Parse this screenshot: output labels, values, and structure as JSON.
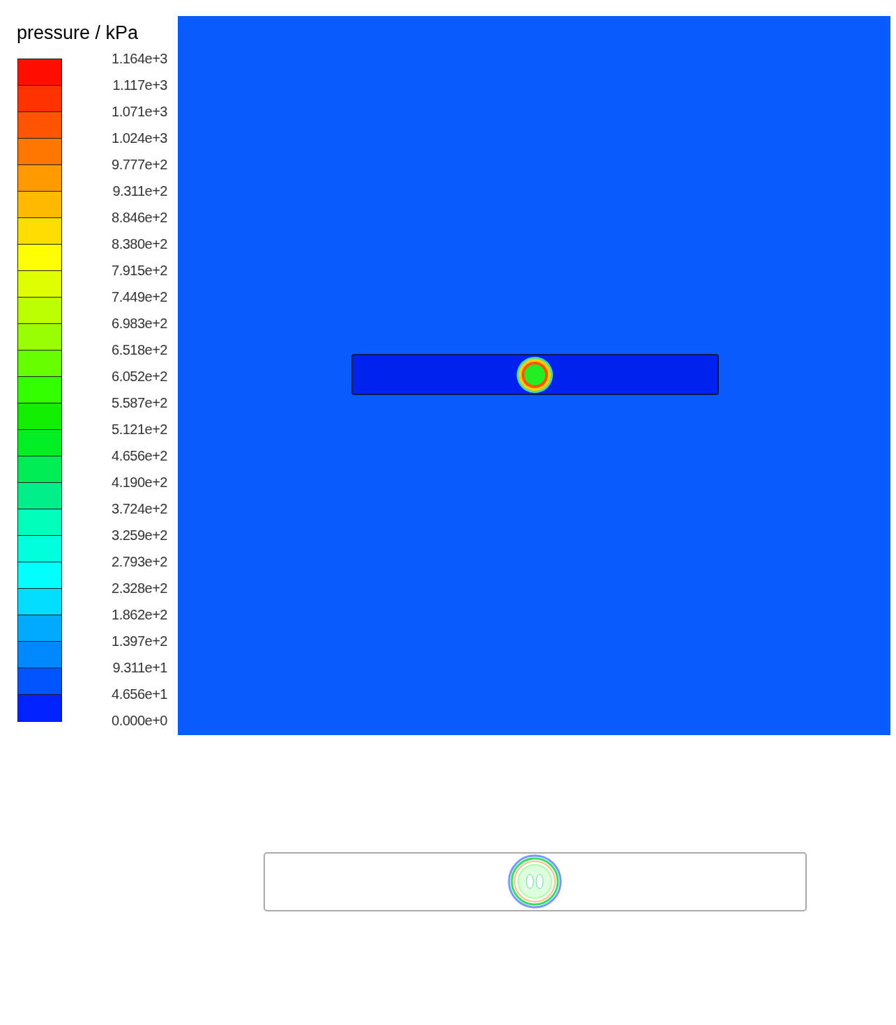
{
  "legend": {
    "title": "pressure / kPa",
    "labels": [
      "1.164e+3",
      "1.117e+3",
      "1.071e+3",
      "1.024e+3",
      "9.777e+2",
      "9.311e+2",
      "8.846e+2",
      "8.380e+2",
      "7.915e+2",
      "7.449e+2",
      "6.983e+2",
      "6.518e+2",
      "6.052e+2",
      "5.587e+2",
      "5.121e+2",
      "4.656e+2",
      "4.190e+2",
      "3.724e+2",
      "3.259e+2",
      "2.793e+2",
      "2.328e+2",
      "1.862e+2",
      "1.397e+2",
      "9.311e+1",
      "4.656e+1",
      "0.000e+0"
    ],
    "bands": [
      {
        "color": "#ff1000"
      },
      {
        "color": "#ff3300"
      },
      {
        "color": "#ff5500"
      },
      {
        "color": "#ff7700"
      },
      {
        "color": "#ff9900"
      },
      {
        "color": "#ffbb00"
      },
      {
        "color": "#ffdd00"
      },
      {
        "color": "#ffff00"
      },
      {
        "color": "#ddff00"
      },
      {
        "color": "#bbff00"
      },
      {
        "color": "#99ff00"
      },
      {
        "color": "#66ff00"
      },
      {
        "color": "#33ff00"
      },
      {
        "color": "#11ee00"
      },
      {
        "color": "#00ee22"
      },
      {
        "color": "#00ee55"
      },
      {
        "color": "#00ee88"
      },
      {
        "color": "#00ffbb"
      },
      {
        "color": "#00ffdd"
      },
      {
        "color": "#00ffff"
      },
      {
        "color": "#00ddff"
      },
      {
        "color": "#00aaff"
      },
      {
        "color": "#0088ff"
      },
      {
        "color": "#0055ff"
      },
      {
        "color": "#0022ff"
      }
    ]
  }
}
